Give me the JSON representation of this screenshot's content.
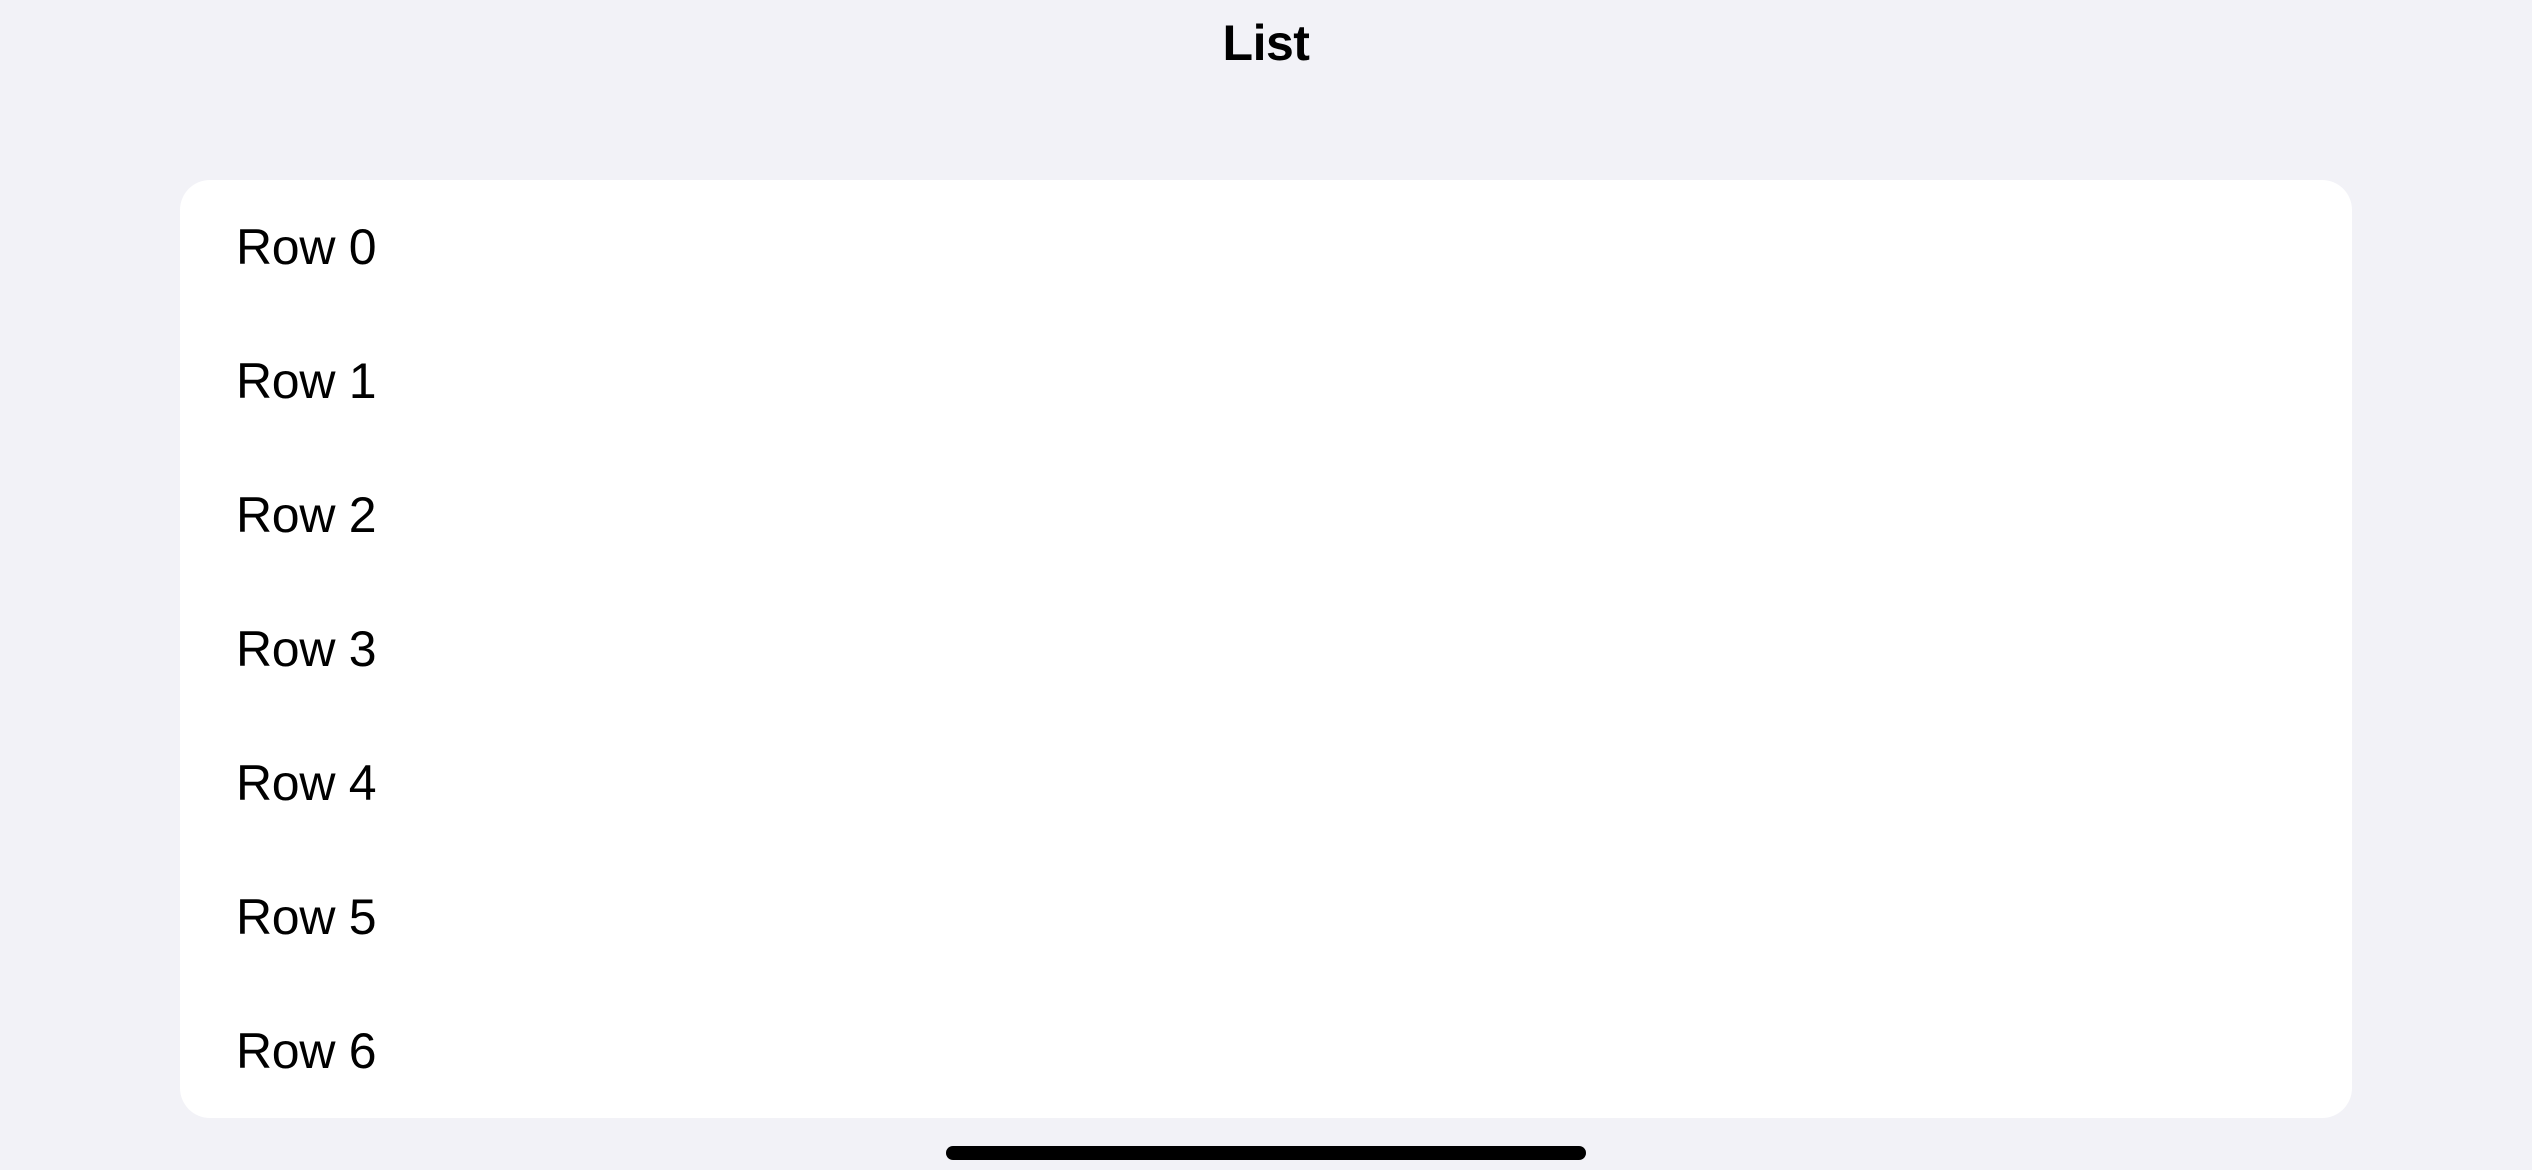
{
  "header": {
    "title": "List"
  },
  "list": {
    "rows": [
      {
        "label": "Row 0"
      },
      {
        "label": "Row 1"
      },
      {
        "label": "Row 2"
      },
      {
        "label": "Row 3"
      },
      {
        "label": "Row 4"
      },
      {
        "label": "Row 5"
      },
      {
        "label": "Row 6"
      }
    ]
  }
}
